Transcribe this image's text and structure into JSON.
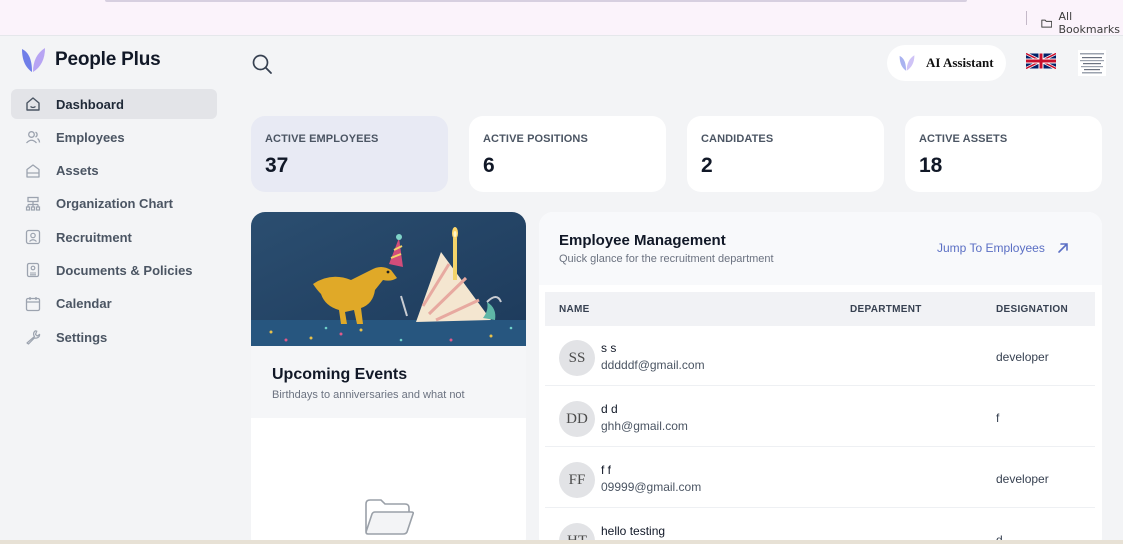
{
  "browser": {
    "bookmarks_label": "All Bookmarks",
    "folder_icon": "folder-icon"
  },
  "app": {
    "brand": "People Plus",
    "accent": "#5b6fc4",
    "logo_colors": [
      "#6f7ee8",
      "#b7a4f3"
    ]
  },
  "sidebar": {
    "items": [
      {
        "label": "Dashboard",
        "icon": "home-icon",
        "active": true
      },
      {
        "label": "Employees",
        "icon": "users-icon",
        "active": false
      },
      {
        "label": "Assets",
        "icon": "box-icon",
        "active": false
      },
      {
        "label": "Organization Chart",
        "icon": "org-chart-icon",
        "active": false
      },
      {
        "label": "Recruitment",
        "icon": "id-badge-icon",
        "active": false
      },
      {
        "label": "Documents & Policies",
        "icon": "document-icon",
        "active": false
      },
      {
        "label": "Calendar",
        "icon": "calendar-icon",
        "active": false
      },
      {
        "label": "Settings",
        "icon": "wrench-icon",
        "active": false
      }
    ]
  },
  "header": {
    "search_icon": "search-icon",
    "ai_assistant_label": "AI Assistant",
    "language_icon": "uk-flag-icon"
  },
  "stats": [
    {
      "label": "ACTIVE EMPLOYEES",
      "value": "37"
    },
    {
      "label": "ACTIVE POSITIONS",
      "value": "6"
    },
    {
      "label": "CANDIDATES",
      "value": "2"
    },
    {
      "label": "ACTIVE ASSETS",
      "value": "18"
    }
  ],
  "events": {
    "title": "Upcoming Events",
    "subtitle": "Birthdays to anniversaries and what not",
    "empty_icon": "folder-open-icon"
  },
  "employee_management": {
    "title": "Employee Management",
    "subtitle": "Quick glance for the recruitment department",
    "jump_label": "Jump To Employees",
    "columns": [
      "NAME",
      "DEPARTMENT",
      "DESIGNATION"
    ],
    "rows": [
      {
        "initials": "SS",
        "name": "s s",
        "email": "dddddf@gmail.com",
        "department": "",
        "designation": "developer"
      },
      {
        "initials": "DD",
        "name": "d d",
        "email": "ghh@gmail.com",
        "department": "",
        "designation": "f"
      },
      {
        "initials": "FF",
        "name": "f f",
        "email": "09999@gmail.com",
        "department": "",
        "designation": "developer"
      },
      {
        "initials": "HT",
        "name": "hello testing",
        "email": "",
        "department": "",
        "designation": "d"
      }
    ]
  }
}
